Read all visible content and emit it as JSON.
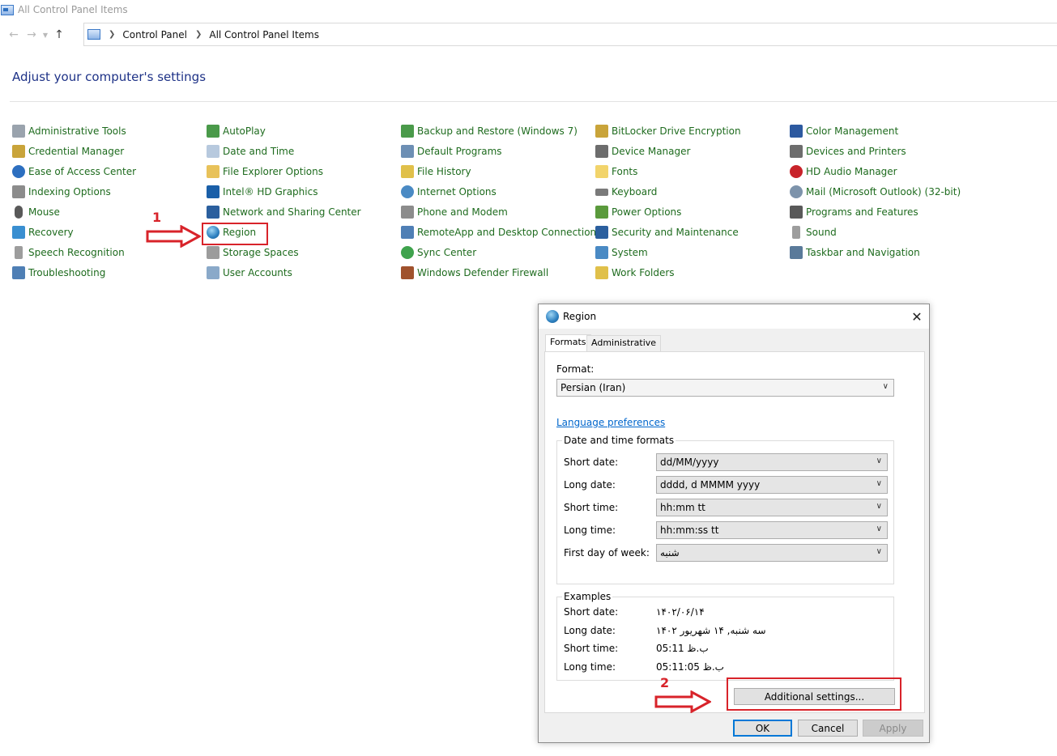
{
  "window": {
    "title": "All Control Panel Items"
  },
  "nav": {
    "breadcrumb": [
      "Control Panel",
      "All Control Panel Items"
    ]
  },
  "page_title": "Adjust your computer's settings",
  "items": [
    [
      "Administrative Tools",
      "Credential Manager",
      "Ease of Access Center",
      "Indexing Options",
      "Mouse",
      "Recovery",
      "Speech Recognition",
      "Troubleshooting"
    ],
    [
      "AutoPlay",
      "Date and Time",
      "File Explorer Options",
      "Intel® HD Graphics",
      "Network and Sharing Center",
      "Region",
      "Storage Spaces",
      "User Accounts"
    ],
    [
      "Backup and Restore (Windows 7)",
      "Default Programs",
      "File History",
      "Internet Options",
      "Phone and Modem",
      "RemoteApp and Desktop Connections",
      "Sync Center",
      "Windows Defender Firewall"
    ],
    [
      "BitLocker Drive Encryption",
      "Device Manager",
      "Fonts",
      "Keyboard",
      "Power Options",
      "Security and Maintenance",
      "System",
      "Work Folders"
    ],
    [
      "Color Management",
      "Devices and Printers",
      "HD Audio Manager",
      "Mail (Microsoft Outlook) (32-bit)",
      "Programs and Features",
      "Sound",
      "Taskbar and Navigation"
    ]
  ],
  "annotations": {
    "step1": "1",
    "step2": "2"
  },
  "dialog": {
    "title": "Region",
    "tabs": [
      "Formats",
      "Administrative"
    ],
    "format_label": "Format:",
    "format_value": "Persian (Iran)",
    "language_link": "Language preferences",
    "date_time_group": "Date and time formats",
    "fields": [
      {
        "label": "Short date:",
        "value": "dd/MM/yyyy"
      },
      {
        "label": "Long date:",
        "value": "dddd, d MMMM yyyy"
      },
      {
        "label": "Short time:",
        "value": "hh:mm tt"
      },
      {
        "label": "Long time:",
        "value": "hh:mm:ss tt"
      },
      {
        "label": "First day of week:",
        "value": "شنبه"
      }
    ],
    "examples_group": "Examples",
    "examples": [
      {
        "label": "Short date:",
        "value": "۱۴۰۲/۰۶/۱۴"
      },
      {
        "label": "Long date:",
        "value": "سه شنبه, ۱۴ شهریور ۱۴۰۲"
      },
      {
        "label": "Short time:",
        "value": "05:11 ب.ظ"
      },
      {
        "label": "Long time:",
        "value": "05:11:05 ب.ظ"
      }
    ],
    "additional_button": "Additional settings...",
    "ok_button": "OK",
    "cancel_button": "Cancel",
    "apply_button": "Apply"
  },
  "colors": {
    "accent": "#1e3287",
    "link": "#1e6b1e",
    "annotation": "#d8232a"
  }
}
